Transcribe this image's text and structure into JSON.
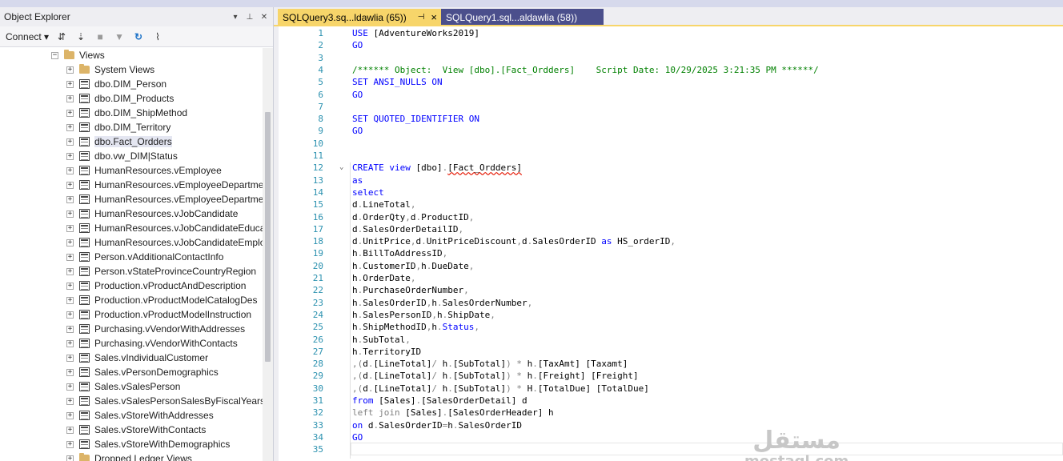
{
  "object_explorer": {
    "title": "Object Explorer",
    "title_controls": [
      "▾",
      "⊥",
      "✕"
    ],
    "connect_label": "Connect",
    "tree": [
      {
        "label": "Views",
        "type": "folder",
        "level": 0,
        "expanded": true
      },
      {
        "label": "System Views",
        "type": "folder",
        "level": 1
      },
      {
        "label": "dbo.DIM_Person",
        "type": "view",
        "level": 1
      },
      {
        "label": "dbo.DIM_Products",
        "type": "view",
        "level": 1
      },
      {
        "label": "dbo.DIM_ShipMethod",
        "type": "view",
        "level": 1
      },
      {
        "label": "dbo.DIM_Territory",
        "type": "view",
        "level": 1
      },
      {
        "label": "dbo.Fact_Ordders",
        "type": "view",
        "level": 1,
        "selected": true
      },
      {
        "label": "dbo.vw_DIM|Status",
        "type": "view",
        "level": 1
      },
      {
        "label": "HumanResources.vEmployee",
        "type": "view",
        "level": 1
      },
      {
        "label": "HumanResources.vEmployeeDepartme",
        "type": "view",
        "level": 1
      },
      {
        "label": "HumanResources.vEmployeeDepartme",
        "type": "view",
        "level": 1
      },
      {
        "label": "HumanResources.vJobCandidate",
        "type": "view",
        "level": 1
      },
      {
        "label": "HumanResources.vJobCandidateEduca",
        "type": "view",
        "level": 1
      },
      {
        "label": "HumanResources.vJobCandidateEmplo",
        "type": "view",
        "level": 1
      },
      {
        "label": "Person.vAdditionalContactInfo",
        "type": "view",
        "level": 1
      },
      {
        "label": "Person.vStateProvinceCountryRegion",
        "type": "view",
        "level": 1
      },
      {
        "label": "Production.vProductAndDescription",
        "type": "view",
        "level": 1
      },
      {
        "label": "Production.vProductModelCatalogDes",
        "type": "view",
        "level": 1
      },
      {
        "label": "Production.vProductModelInstruction",
        "type": "view",
        "level": 1
      },
      {
        "label": "Purchasing.vVendorWithAddresses",
        "type": "view",
        "level": 1
      },
      {
        "label": "Purchasing.vVendorWithContacts",
        "type": "view",
        "level": 1
      },
      {
        "label": "Sales.vIndividualCustomer",
        "type": "view",
        "level": 1
      },
      {
        "label": "Sales.vPersonDemographics",
        "type": "view",
        "level": 1
      },
      {
        "label": "Sales.vSalesPerson",
        "type": "view",
        "level": 1
      },
      {
        "label": "Sales.vSalesPersonSalesByFiscalYears",
        "type": "view",
        "level": 1
      },
      {
        "label": "Sales.vStoreWithAddresses",
        "type": "view",
        "level": 1
      },
      {
        "label": "Sales.vStoreWithContacts",
        "type": "view",
        "level": 1
      },
      {
        "label": "Sales.vStoreWithDemographics",
        "type": "view",
        "level": 1
      },
      {
        "label": "Dropped Ledger Views",
        "type": "folder",
        "level": 1
      }
    ]
  },
  "tabs": [
    {
      "label": "SQLQuery3.sq...ldawlia (65))",
      "active": true
    },
    {
      "label": "SQLQuery1.sql...aldawlia (58))",
      "active": false
    }
  ],
  "editor": {
    "lines": [
      [
        {
          "t": "USE ",
          "c": "kw"
        },
        {
          "t": "[AdventureWorks2019]"
        }
      ],
      [
        {
          "t": "GO",
          "c": "kw"
        }
      ],
      [],
      [
        {
          "t": "/****** Object:  View [dbo].[Fact_Ordders]    Script Date: 10/29/2025 3:21:35 PM ******/",
          "c": "cm"
        }
      ],
      [
        {
          "t": "SET ANSI_NULLS ON",
          "c": "kw"
        }
      ],
      [
        {
          "t": "GO",
          "c": "kw"
        }
      ],
      [],
      [
        {
          "t": "SET QUOTED_IDENTIFIER ON",
          "c": "kw"
        }
      ],
      [
        {
          "t": "GO",
          "c": "kw"
        }
      ],
      [],
      [],
      [
        {
          "t": "CREATE view ",
          "c": "kw"
        },
        {
          "t": "[dbo]",
          "c": ""
        },
        {
          "t": ".",
          "c": "gray"
        },
        {
          "t": "[Fact_Ordders]",
          "c": "err"
        }
      ],
      [
        {
          "t": "as",
          "c": "kw"
        }
      ],
      [
        {
          "t": "select",
          "c": "kw"
        }
      ],
      [
        {
          "t": "d"
        },
        {
          "t": ".",
          "c": "gray"
        },
        {
          "t": "LineTotal"
        },
        {
          "t": ",",
          "c": "gray"
        }
      ],
      [
        {
          "t": "d"
        },
        {
          "t": ".",
          "c": "gray"
        },
        {
          "t": "OrderQty"
        },
        {
          "t": ",",
          "c": "gray"
        },
        {
          "t": "d"
        },
        {
          "t": ".",
          "c": "gray"
        },
        {
          "t": "ProductID"
        },
        {
          "t": ",",
          "c": "gray"
        }
      ],
      [
        {
          "t": "d"
        },
        {
          "t": ".",
          "c": "gray"
        },
        {
          "t": "SalesOrderDetailID"
        },
        {
          "t": ",",
          "c": "gray"
        }
      ],
      [
        {
          "t": "d"
        },
        {
          "t": ".",
          "c": "gray"
        },
        {
          "t": "UnitPrice"
        },
        {
          "t": ",",
          "c": "gray"
        },
        {
          "t": "d"
        },
        {
          "t": ".",
          "c": "gray"
        },
        {
          "t": "UnitPriceDiscount"
        },
        {
          "t": ",",
          "c": "gray"
        },
        {
          "t": "d"
        },
        {
          "t": ".",
          "c": "gray"
        },
        {
          "t": "SalesOrderID "
        },
        {
          "t": "as ",
          "c": "kw"
        },
        {
          "t": "HS_orderID"
        },
        {
          "t": ",",
          "c": "gray"
        }
      ],
      [
        {
          "t": "h"
        },
        {
          "t": ".",
          "c": "gray"
        },
        {
          "t": "BillToAddressID"
        },
        {
          "t": ",",
          "c": "gray"
        }
      ],
      [
        {
          "t": "h"
        },
        {
          "t": ".",
          "c": "gray"
        },
        {
          "t": "CustomerID"
        },
        {
          "t": ",",
          "c": "gray"
        },
        {
          "t": "h"
        },
        {
          "t": ".",
          "c": "gray"
        },
        {
          "t": "DueDate"
        },
        {
          "t": ",",
          "c": "gray"
        }
      ],
      [
        {
          "t": "h"
        },
        {
          "t": ".",
          "c": "gray"
        },
        {
          "t": "OrderDate"
        },
        {
          "t": ",",
          "c": "gray"
        }
      ],
      [
        {
          "t": "h"
        },
        {
          "t": ".",
          "c": "gray"
        },
        {
          "t": "PurchaseOrderNumber"
        },
        {
          "t": ",",
          "c": "gray"
        }
      ],
      [
        {
          "t": "h"
        },
        {
          "t": ".",
          "c": "gray"
        },
        {
          "t": "SalesOrderID"
        },
        {
          "t": ",",
          "c": "gray"
        },
        {
          "t": "h"
        },
        {
          "t": ".",
          "c": "gray"
        },
        {
          "t": "SalesOrderNumber"
        },
        {
          "t": ",",
          "c": "gray"
        }
      ],
      [
        {
          "t": "h"
        },
        {
          "t": ".",
          "c": "gray"
        },
        {
          "t": "SalesPersonID"
        },
        {
          "t": ",",
          "c": "gray"
        },
        {
          "t": "h"
        },
        {
          "t": ".",
          "c": "gray"
        },
        {
          "t": "ShipDate"
        },
        {
          "t": ",",
          "c": "gray"
        }
      ],
      [
        {
          "t": "h"
        },
        {
          "t": ".",
          "c": "gray"
        },
        {
          "t": "ShipMethodID"
        },
        {
          "t": ",",
          "c": "gray"
        },
        {
          "t": "h"
        },
        {
          "t": ".",
          "c": "gray"
        },
        {
          "t": "Status",
          "c": "kw"
        },
        {
          "t": ",",
          "c": "gray"
        }
      ],
      [
        {
          "t": "h"
        },
        {
          "t": ".",
          "c": "gray"
        },
        {
          "t": "SubTotal"
        },
        {
          "t": ",",
          "c": "gray"
        }
      ],
      [
        {
          "t": "h"
        },
        {
          "t": ".",
          "c": "gray"
        },
        {
          "t": "TerritoryID"
        }
      ],
      [
        {
          "t": ",(",
          "c": "gray"
        },
        {
          "t": "d"
        },
        {
          "t": ".",
          "c": "gray"
        },
        {
          "t": "[LineTotal]"
        },
        {
          "t": "/ ",
          "c": "gray"
        },
        {
          "t": "h"
        },
        {
          "t": ".",
          "c": "gray"
        },
        {
          "t": "[SubTotal]"
        },
        {
          "t": ") * ",
          "c": "gray"
        },
        {
          "t": "h"
        },
        {
          "t": ".",
          "c": "gray"
        },
        {
          "t": "[TaxAmt] [Taxamt]"
        }
      ],
      [
        {
          "t": ",(",
          "c": "gray"
        },
        {
          "t": "d"
        },
        {
          "t": ".",
          "c": "gray"
        },
        {
          "t": "[LineTotal]"
        },
        {
          "t": "/ ",
          "c": "gray"
        },
        {
          "t": "h"
        },
        {
          "t": ".",
          "c": "gray"
        },
        {
          "t": "[SubTotal]"
        },
        {
          "t": ") * ",
          "c": "gray"
        },
        {
          "t": "h"
        },
        {
          "t": ".",
          "c": "gray"
        },
        {
          "t": "[Freight] [Freight]"
        }
      ],
      [
        {
          "t": ",(",
          "c": "gray"
        },
        {
          "t": "d"
        },
        {
          "t": ".",
          "c": "gray"
        },
        {
          "t": "[LineTotal]"
        },
        {
          "t": "/ ",
          "c": "gray"
        },
        {
          "t": "h"
        },
        {
          "t": ".",
          "c": "gray"
        },
        {
          "t": "[SubTotal]"
        },
        {
          "t": ") * ",
          "c": "gray"
        },
        {
          "t": "H"
        },
        {
          "t": ".",
          "c": "gray"
        },
        {
          "t": "[TotalDue] [TotalDue]"
        }
      ],
      [
        {
          "t": "from ",
          "c": "kw"
        },
        {
          "t": "[Sales]"
        },
        {
          "t": ".",
          "c": "gray"
        },
        {
          "t": "[SalesOrderDetail] d"
        }
      ],
      [
        {
          "t": "left join ",
          "c": "gray"
        },
        {
          "t": "[Sales]"
        },
        {
          "t": ".",
          "c": "gray"
        },
        {
          "t": "[SalesOrderHeader] h"
        }
      ],
      [
        {
          "t": "on ",
          "c": "kw"
        },
        {
          "t": "d"
        },
        {
          "t": ".",
          "c": "gray"
        },
        {
          "t": "SalesOrderID"
        },
        {
          "t": "=",
          "c": "gray"
        },
        {
          "t": "h"
        },
        {
          "t": ".",
          "c": "gray"
        },
        {
          "t": "SalesOrderID"
        }
      ],
      [
        {
          "t": "GO",
          "c": "kw"
        }
      ],
      []
    ]
  },
  "watermark": {
    "line1": "مستقل",
    "line2": "mostaql.com"
  }
}
